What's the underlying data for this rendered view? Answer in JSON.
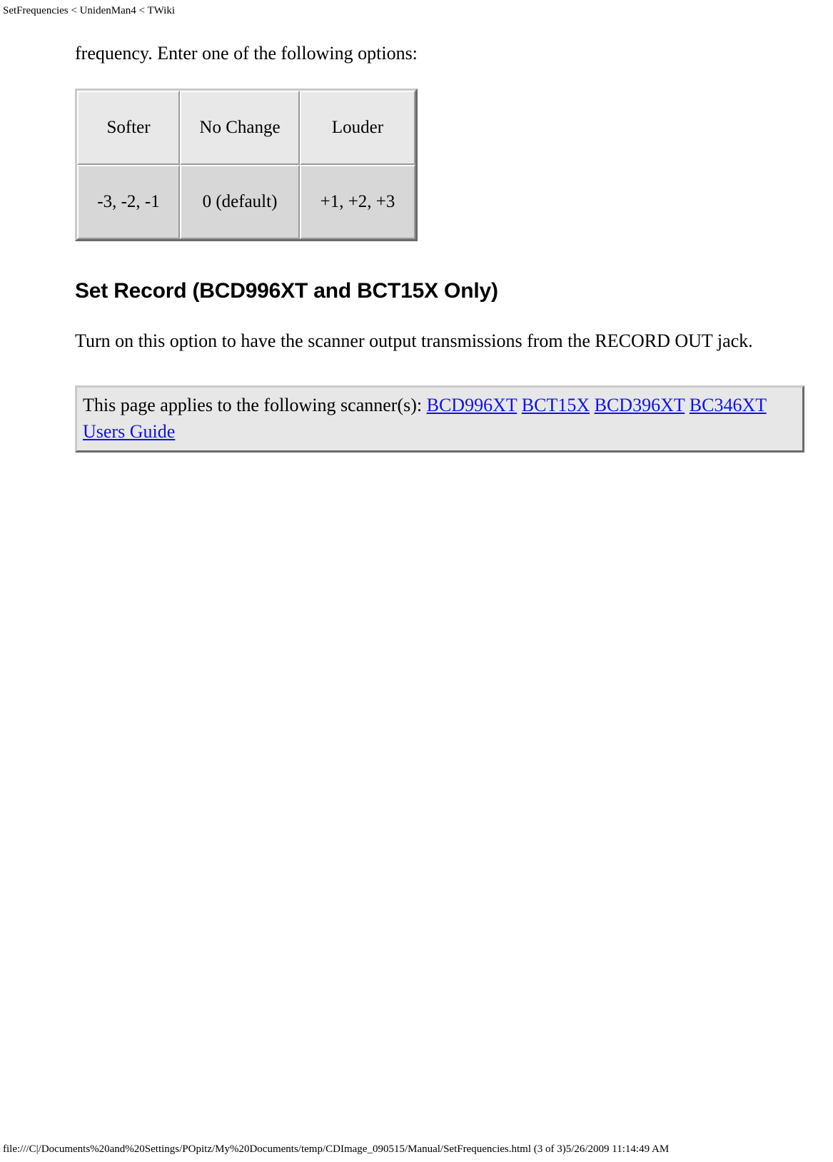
{
  "page": {
    "header": "SetFrequencies < UnidenMan4 < TWiki",
    "footer": "file:///C|/Documents%20and%20Settings/POpitz/My%20Documents/temp/CDImage_090515/Manual/SetFrequencies.html (3 of 3)5/26/2009 11:14:49 AM"
  },
  "content": {
    "intro_paragraph": "frequency. Enter one of the following options:",
    "options_table": {
      "headers": [
        "Softer",
        "No Change",
        "Louder"
      ],
      "rows": [
        [
          "-3, -2, -1",
          "0 (default)",
          "+1, +2, +3"
        ]
      ]
    },
    "section": {
      "heading": "Set Record (BCD996XT and BCT15X Only)",
      "paragraph": "Turn on this option to have the scanner output transmissions from the RECORD OUT jack."
    },
    "applies_box": {
      "lead_text": "This page applies to the following scanner(s):",
      "links": [
        {
          "label": "BCD996XT"
        },
        {
          "label": "BCT15X"
        },
        {
          "label": "BCD396XT"
        },
        {
          "label": "BC346XT"
        },
        {
          "label": "Users Guide"
        }
      ]
    }
  },
  "colors": {
    "link": "#1010ee",
    "table_header_bg": "#e8e8e8",
    "table_cell_bg": "#d7d7d7",
    "box_bg": "#e7e7e7",
    "border_light": "#c9c9c9",
    "border_dark": "#6a6a6a"
  }
}
